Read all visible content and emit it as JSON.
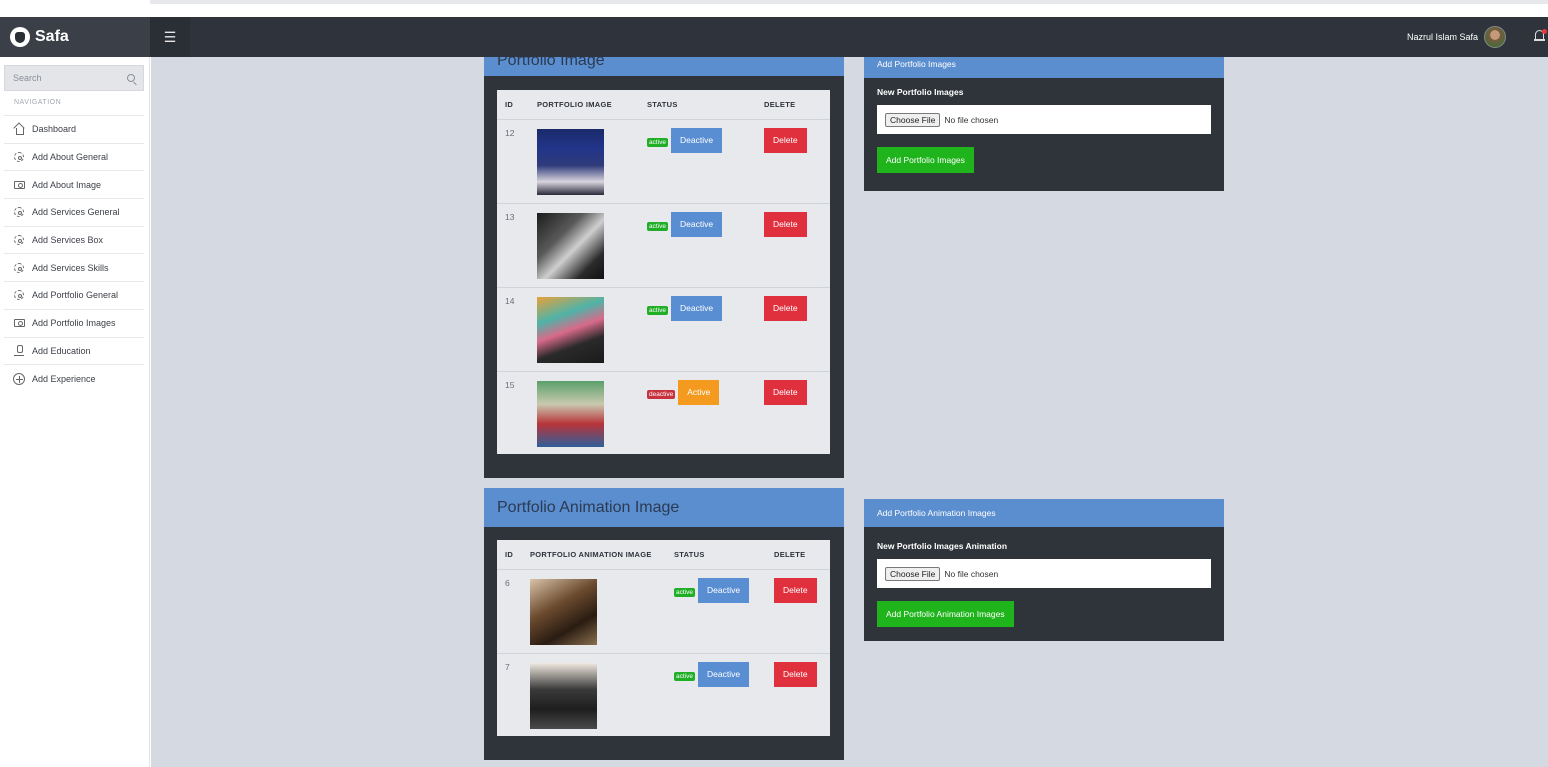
{
  "brand": {
    "name": "Safa"
  },
  "topbar": {
    "user_name": "Nazrul Islam Safa"
  },
  "sidebar": {
    "search_placeholder": "Search",
    "nav_heading": "NAVIGATION",
    "items": [
      {
        "label": "Dashboard",
        "icon": "home-icon"
      },
      {
        "label": "Add About General",
        "icon": "gear-icon"
      },
      {
        "label": "Add About Image",
        "icon": "camera-icon"
      },
      {
        "label": "Add Services General",
        "icon": "gear-icon"
      },
      {
        "label": "Add Services Box",
        "icon": "gear-icon"
      },
      {
        "label": "Add Services Skills",
        "icon": "gear-icon"
      },
      {
        "label": "Add Portfolio General",
        "icon": "gear-icon"
      },
      {
        "label": "Add Portfolio Images",
        "icon": "camera-icon"
      },
      {
        "label": "Add Education",
        "icon": "user-icon"
      },
      {
        "label": "Add Experience",
        "icon": "plus-circle-icon"
      }
    ]
  },
  "portfolio": {
    "title": "Portfolio Image",
    "columns": [
      "ID",
      "PORTFOLIO IMAGE",
      "STATUS",
      "DELETE"
    ],
    "rows": [
      {
        "id": "12",
        "badge": "active",
        "toggle": "Deactive",
        "delete": "Delete"
      },
      {
        "id": "13",
        "badge": "active",
        "toggle": "Deactive",
        "delete": "Delete"
      },
      {
        "id": "14",
        "badge": "active",
        "toggle": "Deactive",
        "delete": "Delete"
      },
      {
        "id": "15",
        "badge": "deactive",
        "toggle": "Active",
        "delete": "Delete"
      }
    ]
  },
  "portfolio_form": {
    "title": "Add Portfolio Images",
    "label": "New Portfolio Images",
    "choose": "Choose File",
    "no_file": "No file chosen",
    "submit": "Add Portfolio Images"
  },
  "animation": {
    "title": "Portfolio Animation Image",
    "columns": [
      "ID",
      "PORTFOLIO ANIMATION IMAGE",
      "STATUS",
      "DELETE"
    ],
    "rows": [
      {
        "id": "6",
        "badge": "active",
        "toggle": "Deactive",
        "delete": "Delete"
      },
      {
        "id": "7",
        "badge": "active",
        "toggle": "Deactive",
        "delete": "Delete"
      }
    ]
  },
  "animation_form": {
    "title": "Add Portfolio Animation Images",
    "label": "New Portfolio Images Animation",
    "choose": "Choose File",
    "no_file": "No file chosen",
    "submit": "Add Portfolio Animation Images"
  },
  "colors": {
    "sidebar_bg": "#ffffff",
    "topbar_bg": "#2f343c",
    "panel_bg": "#2f343b",
    "panel_head": "#5b8ecf",
    "active_green": "#1fae26",
    "deactive_red": "#c8323e",
    "btn_blue": "#5a8ed3",
    "btn_orange": "#f39a1f",
    "btn_red": "#e0303e",
    "submit_green": "#1fb41c",
    "content_bg": "#d5d9e1"
  }
}
